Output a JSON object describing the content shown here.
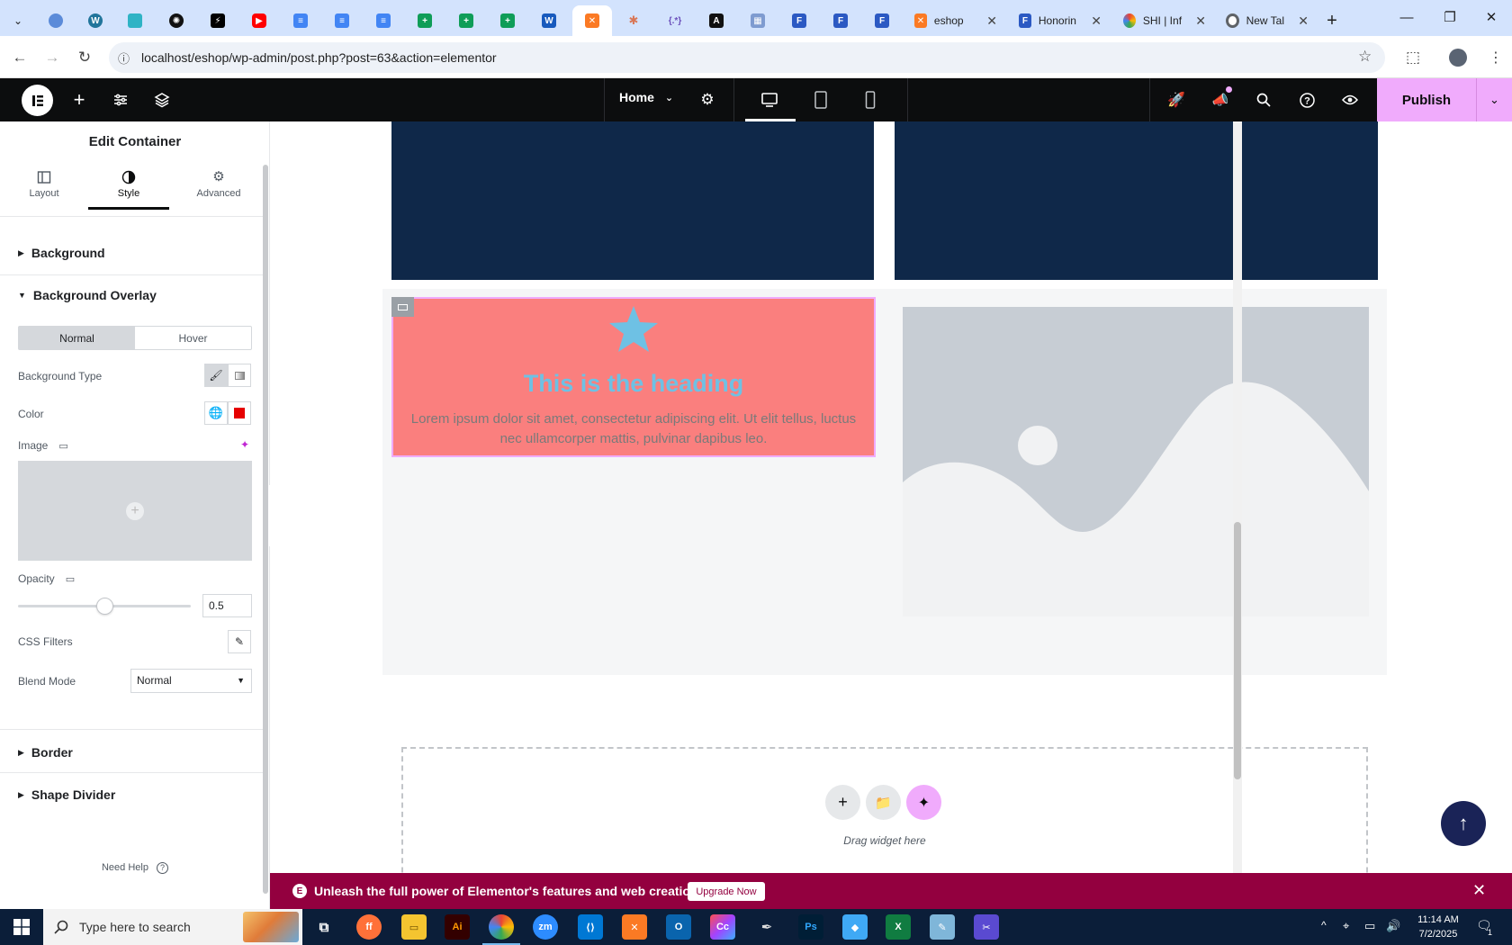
{
  "browser": {
    "tabs": [
      {
        "icon": "tab-list-icon"
      },
      {
        "icon": "globe-icon"
      },
      {
        "icon": "wordpress-icon"
      },
      {
        "icon": "codesandbox-icon"
      },
      {
        "icon": "openai-icon"
      },
      {
        "icon": "bolt-icon"
      },
      {
        "icon": "youtube-icon"
      },
      {
        "icon": "docs-icon"
      },
      {
        "icon": "docs-icon"
      },
      {
        "icon": "docs-icon"
      },
      {
        "icon": "sheets-icon"
      },
      {
        "icon": "sheets-icon"
      },
      {
        "icon": "sheets-icon"
      },
      {
        "icon": "word-icon"
      },
      {
        "icon": "xampp-icon",
        "active": true
      },
      {
        "icon": "claude-icon"
      },
      {
        "icon": "regex-icon"
      },
      {
        "icon": "ai-icon"
      },
      {
        "icon": "grid-icon"
      },
      {
        "icon": "forms-icon"
      },
      {
        "icon": "forms-icon"
      },
      {
        "icon": "forms-icon"
      }
    ],
    "named_tabs": [
      {
        "title": "eshop",
        "icon": "xampp-icon"
      },
      {
        "title": "Honorin",
        "icon": "forms-icon"
      },
      {
        "title": "SHI | Inf",
        "icon": "color-wheel-icon"
      },
      {
        "title": "New Tal",
        "icon": "chrome-icon"
      }
    ],
    "new_tab": "+",
    "url": "localhost/eshop/wp-admin/post.php?post=63&action=elementor"
  },
  "elementor_topbar": {
    "page_name": "Home",
    "publish_label": "Publish"
  },
  "panel": {
    "title": "Edit Container",
    "tabs": [
      {
        "label": "Layout"
      },
      {
        "label": "Style"
      },
      {
        "label": "Advanced"
      }
    ],
    "sections": {
      "background": "Background",
      "background_overlay": "Background Overlay",
      "border": "Border",
      "shape_divider": "Shape Divider"
    },
    "state_toggle": {
      "normal": "Normal",
      "hover": "Hover"
    },
    "labels": {
      "background_type": "Background Type",
      "color": "Color",
      "image": "Image",
      "opacity": "Opacity",
      "css_filters": "CSS Filters",
      "blend_mode": "Blend Mode"
    },
    "overlay_color": "#e60000",
    "opacity_value": "0.5",
    "opacity_fraction": 0.5,
    "blend_mode_value": "Normal",
    "need_help": "Need Help"
  },
  "canvas": {
    "heading": "This is the heading",
    "body_text": "Lorem ipsum dolor sit amet, consectetur adipiscing elit. Ut elit tellus, luctus nec ullamcorper mattis, pulvinar dapibus leo.",
    "drag_widget": "Drag widget here"
  },
  "promo": {
    "text": "Unleash the full power of Elementor's features and web creation tools.",
    "button": "Upgrade Now"
  },
  "taskbar": {
    "search_placeholder": "Type here to search",
    "time": "11:14 AM",
    "date": "7/2/2025",
    "notification_count": "1"
  }
}
